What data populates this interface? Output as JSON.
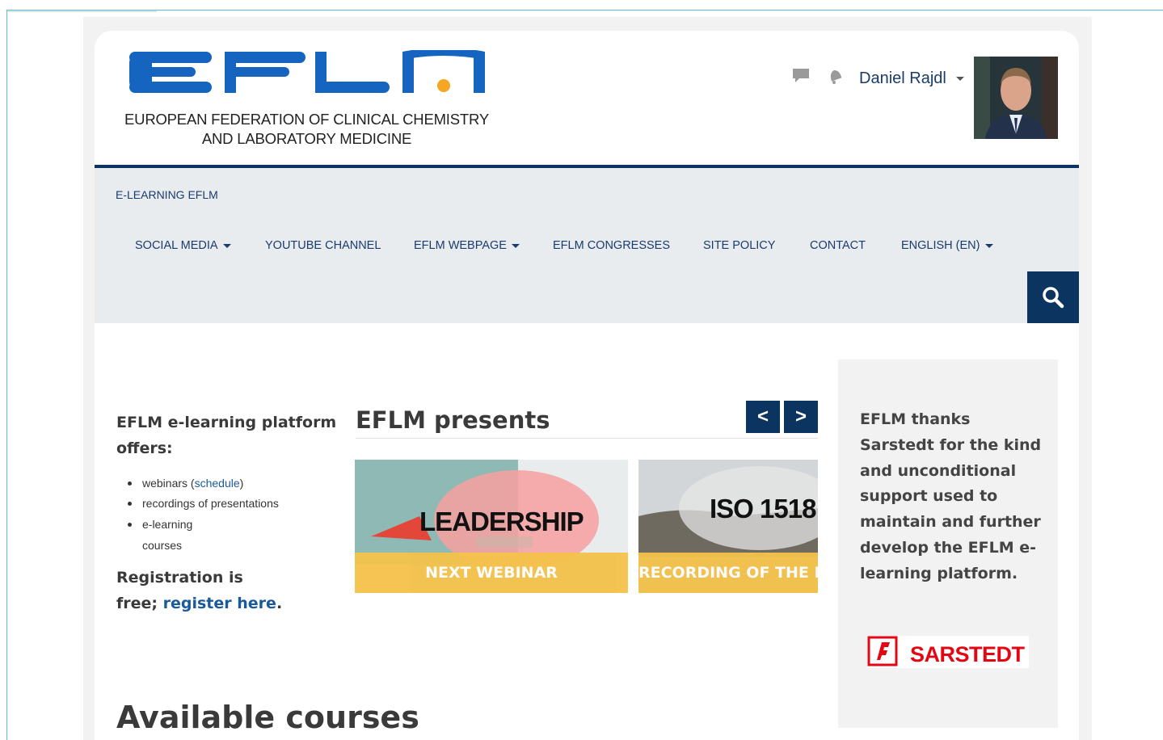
{
  "header": {
    "logo_text": "EFLM",
    "org_line1": "EUROPEAN FEDERATION OF CLINICAL CHEMISTRY",
    "org_line2": "AND LABORATORY MEDICINE",
    "user_name": "Daniel Rajdl",
    "icons": [
      "chat-icon",
      "bell-icon"
    ]
  },
  "nav": {
    "brand": "E-LEARNING EFLM",
    "items": [
      {
        "label": "SOCIAL MEDIA",
        "dropdown": true
      },
      {
        "label": "YOUTUBE CHANNEL",
        "dropdown": false
      },
      {
        "label": "EFLM WEBPAGE",
        "dropdown": true
      },
      {
        "label": "EFLM CONGRESSES",
        "dropdown": false
      },
      {
        "label": "SITE POLICY",
        "dropdown": false
      },
      {
        "label": "CONTACT",
        "dropdown": false
      },
      {
        "label": "ENGLISH (EN)",
        "dropdown": true
      }
    ]
  },
  "left": {
    "heading": "EFLM e-learning platform offers:",
    "heading_line1": "EFLM e-learning platform",
    "heading_line2": "offers:",
    "list": [
      {
        "text": "webinars",
        "link": "schedule"
      },
      {
        "text": "recordings of presentations"
      },
      {
        "text": "e-learning"
      },
      {
        "text": "courses"
      }
    ],
    "reg_line1": "Registration is",
    "reg_prefix": "free; ",
    "reg_link": "register here",
    "reg_suffix": "."
  },
  "presents": {
    "title": "EFLM presents",
    "prev_label": "<",
    "next_label": ">",
    "slides": [
      {
        "image_text": "LEADERSHIP",
        "caption": "NEXT WEBINAR"
      },
      {
        "image_text": "ISO 1518",
        "caption": "RECORDING OF THE LA"
      }
    ]
  },
  "sponsor": {
    "text": "EFLM thanks Sarstedt for the kind and unconditional support used to maintain and further develop the EFLM e-learning platform.",
    "logo_text": "SARSTEDT"
  },
  "main": {
    "courses_title": "Available courses"
  },
  "colors": {
    "navy": "#0b3460",
    "logo_blue": "#1565c0",
    "accent_orange": "#f5a623",
    "banner_yellow": "#f5c24a",
    "sarstedt_red": "#e30613"
  }
}
